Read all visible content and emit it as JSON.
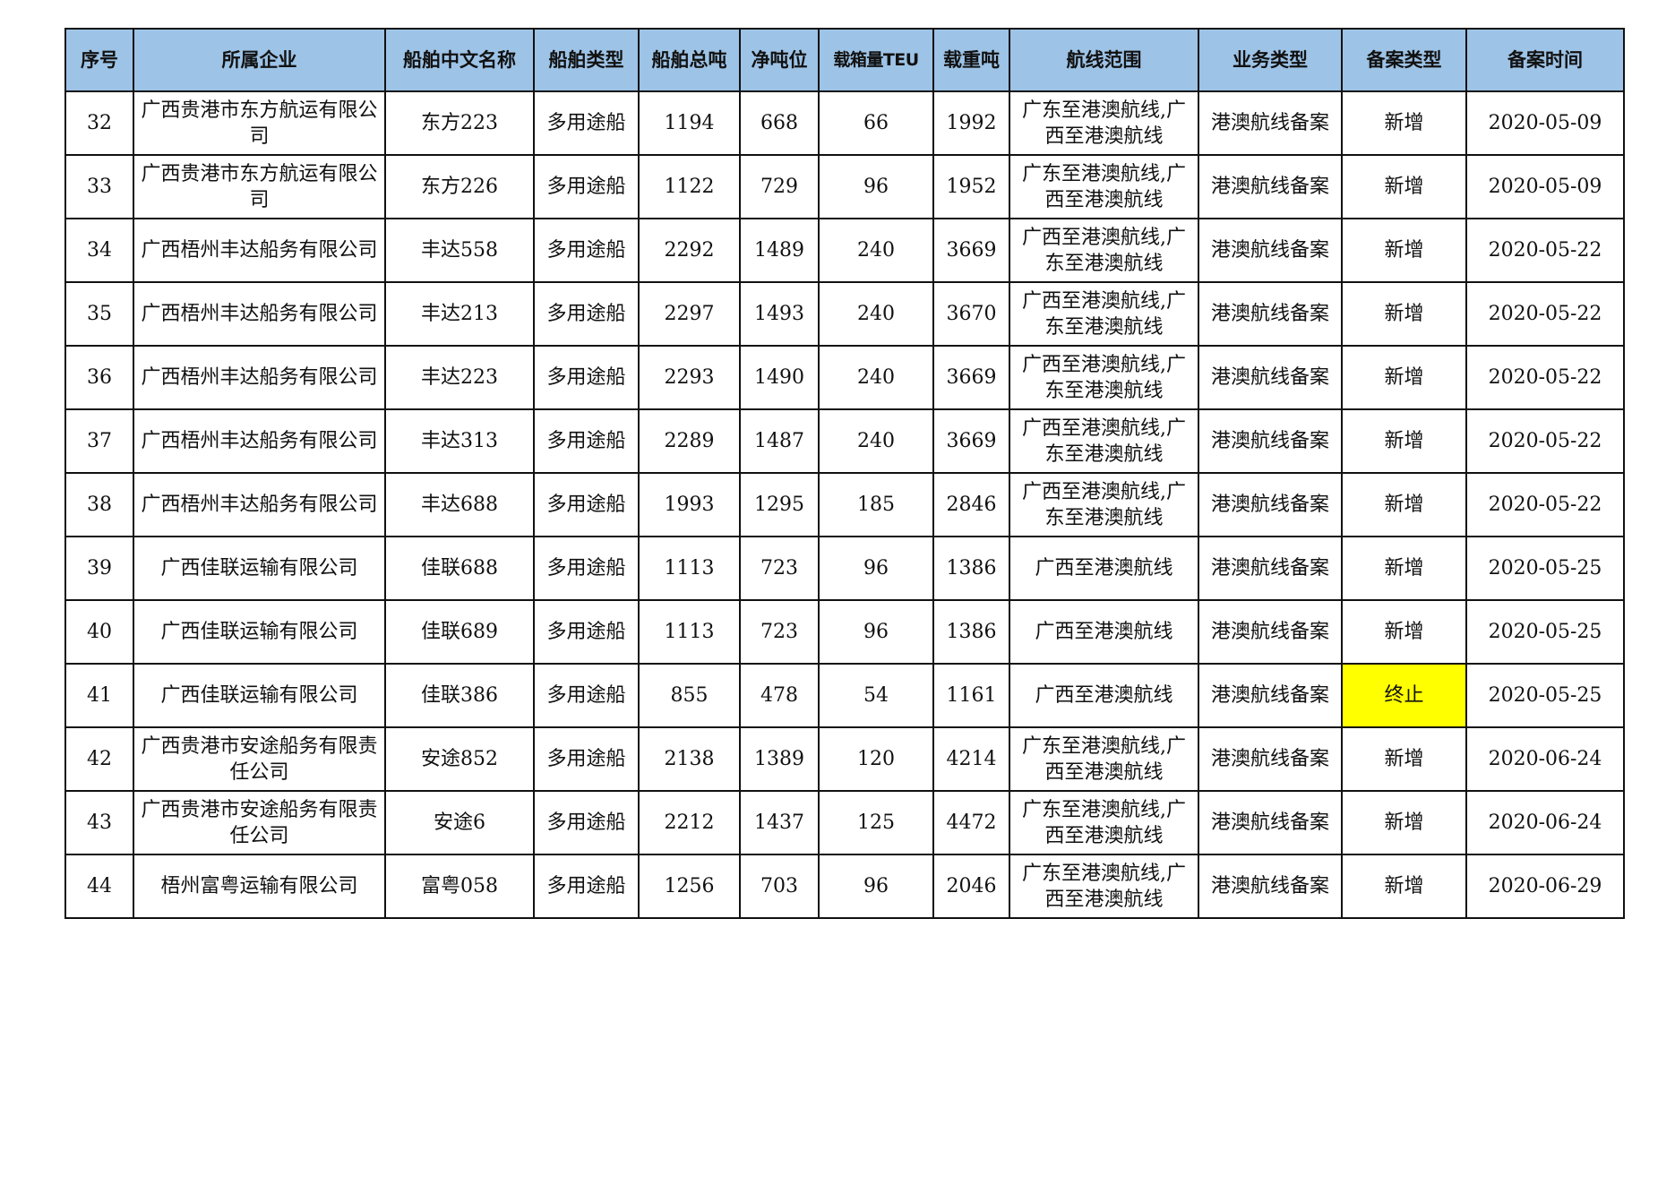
{
  "colors": {
    "header_bg": "#9dc3e6",
    "highlight_bg": "#ffff00",
    "border": "#111111"
  },
  "table": {
    "headers": [
      "序号",
      "所属企业",
      "船舶中文名称",
      "船舶类型",
      "船舶总吨",
      "净吨位",
      "载箱量TEU",
      "载重吨",
      "航线范围",
      "业务类型",
      "备案类型",
      "备案时间"
    ],
    "rows": [
      {
        "cells": [
          "32",
          "广西贵港市东方航运有限公司",
          "东方223",
          "多用途船",
          "1194",
          "668",
          "66",
          "1992",
          "广东至港澳航线,广西至港澳航线",
          "港澳航线备案",
          "新增",
          "2020-05-09"
        ]
      },
      {
        "cells": [
          "33",
          "广西贵港市东方航运有限公司",
          "东方226",
          "多用途船",
          "1122",
          "729",
          "96",
          "1952",
          "广东至港澳航线,广西至港澳航线",
          "港澳航线备案",
          "新增",
          "2020-05-09"
        ]
      },
      {
        "cells": [
          "34",
          "广西梧州丰达船务有限公司",
          "丰达558",
          "多用途船",
          "2292",
          "1489",
          "240",
          "3669",
          "广西至港澳航线,广东至港澳航线",
          "港澳航线备案",
          "新增",
          "2020-05-22"
        ]
      },
      {
        "cells": [
          "35",
          "广西梧州丰达船务有限公司",
          "丰达213",
          "多用途船",
          "2297",
          "1493",
          "240",
          "3670",
          "广西至港澳航线,广东至港澳航线",
          "港澳航线备案",
          "新增",
          "2020-05-22"
        ]
      },
      {
        "cells": [
          "36",
          "广西梧州丰达船务有限公司",
          "丰达223",
          "多用途船",
          "2293",
          "1490",
          "240",
          "3669",
          "广西至港澳航线,广东至港澳航线",
          "港澳航线备案",
          "新增",
          "2020-05-22"
        ]
      },
      {
        "cells": [
          "37",
          "广西梧州丰达船务有限公司",
          "丰达313",
          "多用途船",
          "2289",
          "1487",
          "240",
          "3669",
          "广西至港澳航线,广东至港澳航线",
          "港澳航线备案",
          "新增",
          "2020-05-22"
        ]
      },
      {
        "cells": [
          "38",
          "广西梧州丰达船务有限公司",
          "丰达688",
          "多用途船",
          "1993",
          "1295",
          "185",
          "2846",
          "广西至港澳航线,广东至港澳航线",
          "港澳航线备案",
          "新增",
          "2020-05-22"
        ]
      },
      {
        "cells": [
          "39",
          "广西佳联运输有限公司",
          "佳联688",
          "多用途船",
          "1113",
          "723",
          "96",
          "1386",
          "广西至港澳航线",
          "港澳航线备案",
          "新增",
          "2020-05-25"
        ]
      },
      {
        "cells": [
          "40",
          "广西佳联运输有限公司",
          "佳联689",
          "多用途船",
          "1113",
          "723",
          "96",
          "1386",
          "广西至港澳航线",
          "港澳航线备案",
          "新增",
          "2020-05-25"
        ]
      },
      {
        "cells": [
          "41",
          "广西佳联运输有限公司",
          "佳联386",
          "多用途船",
          "855",
          "478",
          "54",
          "1161",
          "广西至港澳航线",
          "港澳航线备案",
          "终止",
          "2020-05-25"
        ],
        "highlight_col": 10
      },
      {
        "cells": [
          "42",
          "广西贵港市安途船务有限责任公司",
          "安途852",
          "多用途船",
          "2138",
          "1389",
          "120",
          "4214",
          "广东至港澳航线,广西至港澳航线",
          "港澳航线备案",
          "新增",
          "2020-06-24"
        ]
      },
      {
        "cells": [
          "43",
          "广西贵港市安途船务有限责任公司",
          "安途6",
          "多用途船",
          "2212",
          "1437",
          "125",
          "4472",
          "广东至港澳航线,广西至港澳航线",
          "港澳航线备案",
          "新增",
          "2020-06-24"
        ]
      },
      {
        "cells": [
          "44",
          "梧州富粤运输有限公司",
          "富粤058",
          "多用途船",
          "1256",
          "703",
          "96",
          "2046",
          "广东至港澳航线,广西至港澳航线",
          "港澳航线备案",
          "新增",
          "2020-06-29"
        ]
      }
    ]
  }
}
